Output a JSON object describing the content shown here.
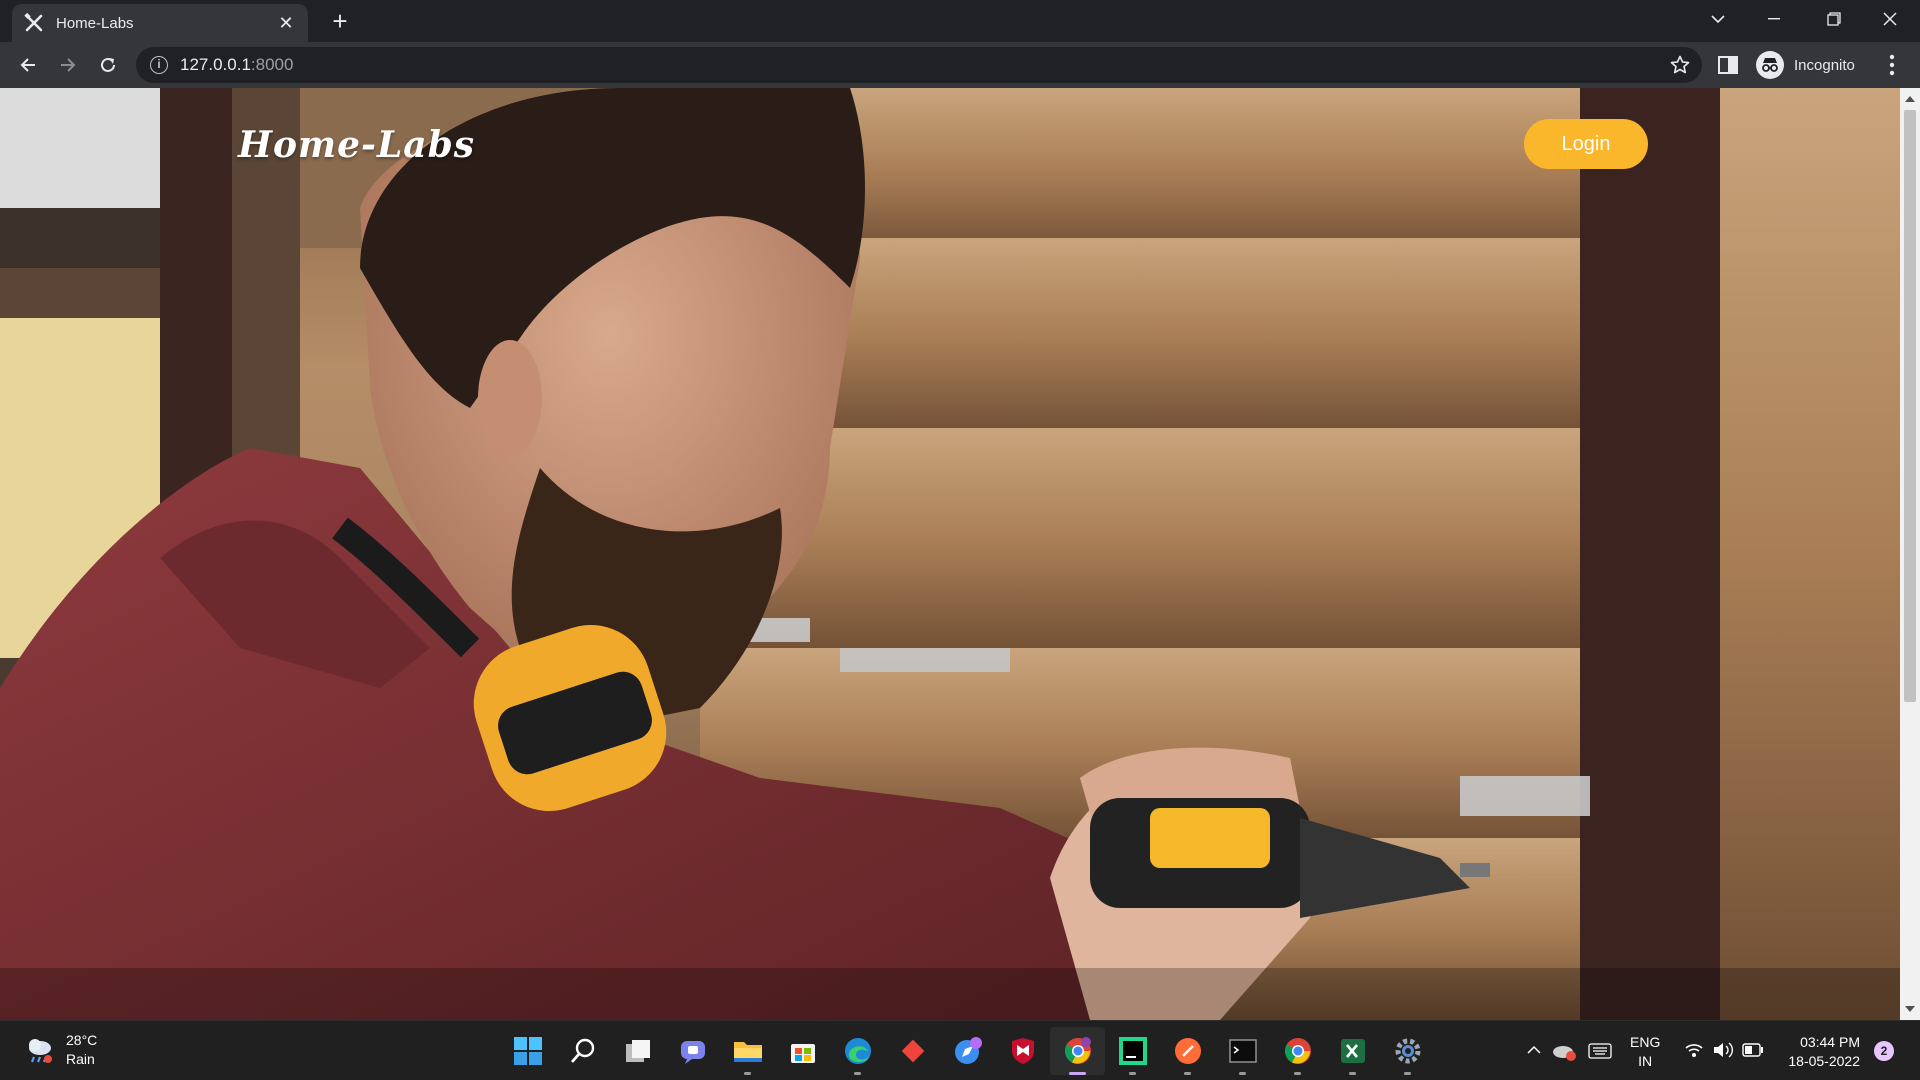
{
  "browser": {
    "tab_title": "Home-Labs",
    "url_host": "127.0.0.1",
    "url_port": ":8000",
    "incognito_label": "Incognito",
    "favicon": "tools-icon"
  },
  "page": {
    "brand": "Home-Labs",
    "login_label": "Login",
    "accent_color": "#fbb72b",
    "hero_image": "man in red hoodie drilling into log wall"
  },
  "taskbar": {
    "weather_temp": "28°C",
    "weather_desc": "Rain",
    "apps": [
      "start",
      "search",
      "task-view",
      "teams",
      "file-explorer",
      "store",
      "edge",
      "anydesk",
      "safari-style-browser",
      "mcafee",
      "chrome",
      "pycharm",
      "postman",
      "terminal",
      "chrome-profile",
      "excel",
      "settings"
    ],
    "lang_1": "ENG",
    "lang_2": "IN",
    "time": "03:44 PM",
    "date": "18-05-2022",
    "notifications": "2"
  }
}
